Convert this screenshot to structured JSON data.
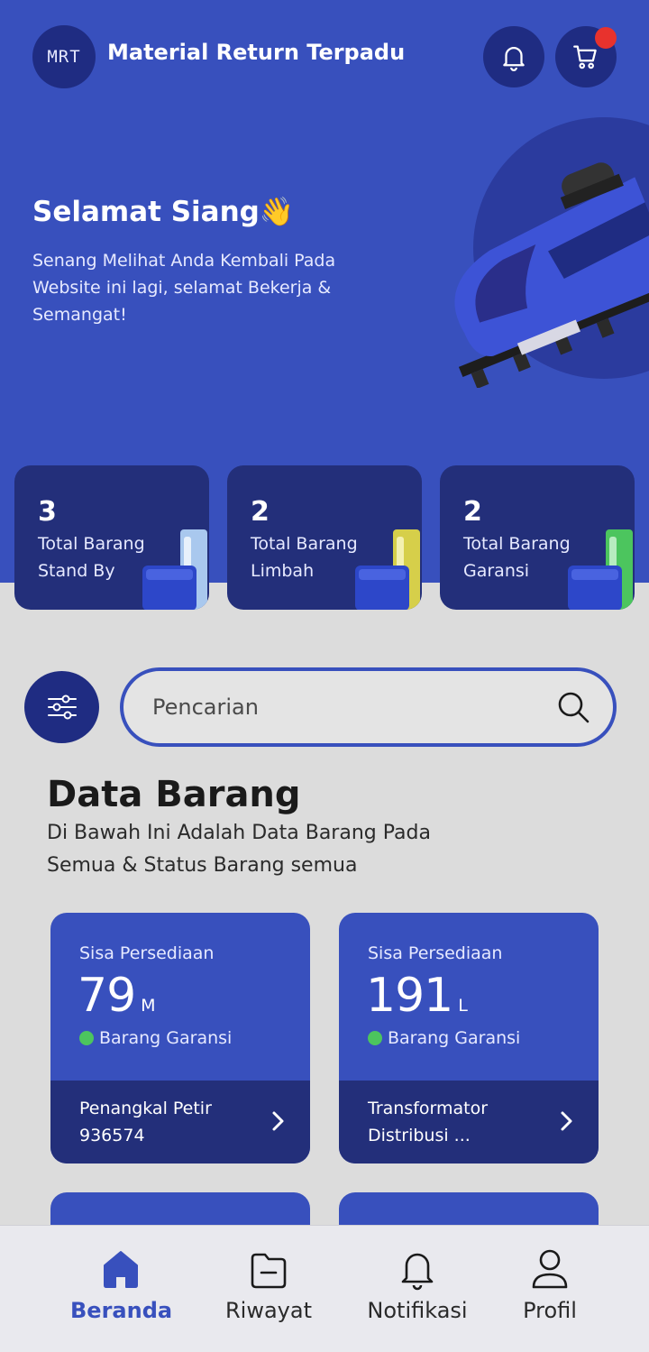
{
  "header": {
    "logo_text": "MRT",
    "app_title": "Material Return Terpadu",
    "cart_badge_color": "#e8322d"
  },
  "hero": {
    "greeting": "Selamat Siang👋",
    "message": "Senang Melihat Anda Kembali Pada Website ini lagi, selamat Bekerja & Semangat!"
  },
  "stats": [
    {
      "value": "3",
      "label": "Total Barang Stand By",
      "accent": "#a9c8ee"
    },
    {
      "value": "2",
      "label": "Total Barang Limbah",
      "accent": "#d6cf4a"
    },
    {
      "value": "2",
      "label": "Total Barang Garansi",
      "accent": "#4cc55e"
    }
  ],
  "search": {
    "placeholder": "Pencarian"
  },
  "section": {
    "title": "Data Barang",
    "subtitle": "Di Bawah Ini Adalah Data Barang Pada Semua & Status Barang semua"
  },
  "items": [
    {
      "stock_label": "Sisa Persediaan",
      "quantity": "79",
      "unit": "M",
      "status": "Barang Garansi",
      "name": "Penangkal Petir 936574"
    },
    {
      "stock_label": "Sisa Persediaan",
      "quantity": "191",
      "unit": "L",
      "status": "Barang Garansi",
      "name": "Transformator Distribusi ..."
    }
  ],
  "nav": [
    {
      "label": "Beranda",
      "icon": "home-icon",
      "active": true
    },
    {
      "label": "Riwayat",
      "icon": "folder-icon",
      "active": false
    },
    {
      "label": "Notifikasi",
      "icon": "bell-icon",
      "active": false
    },
    {
      "label": "Profil",
      "icon": "user-icon",
      "active": false
    }
  ],
  "colors": {
    "primary": "#3850bd",
    "primary_dark": "#232f7a",
    "status_green": "#4cc55e"
  }
}
